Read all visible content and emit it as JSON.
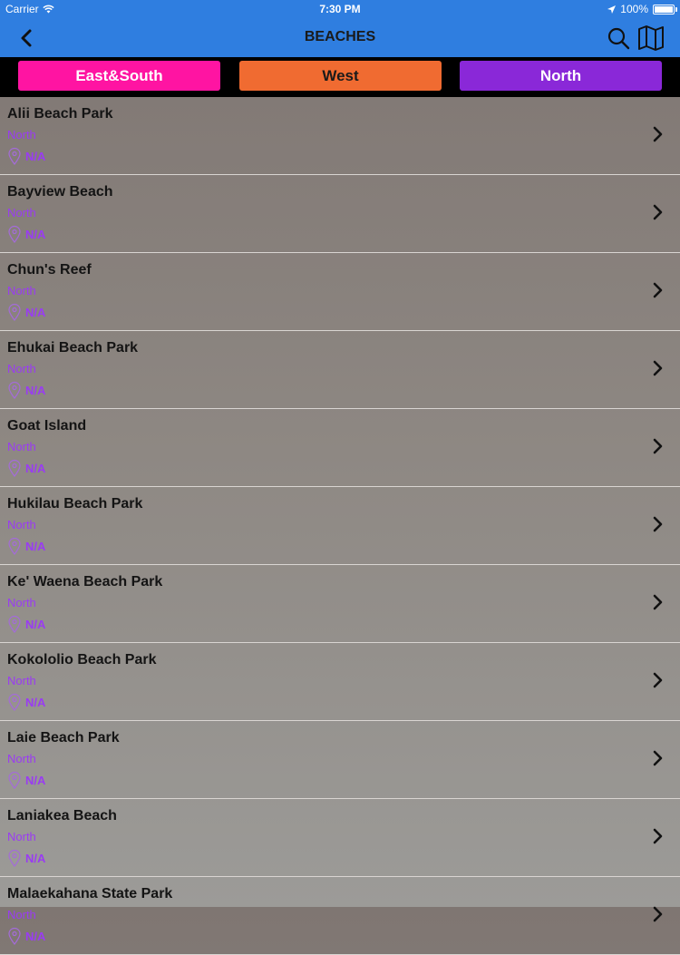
{
  "status": {
    "carrier": "Carrier",
    "time": "7:30 PM",
    "battery": "100%"
  },
  "nav": {
    "title": "BEACHES"
  },
  "tabs": [
    {
      "label": "East&South"
    },
    {
      "label": "West"
    },
    {
      "label": "North"
    }
  ],
  "beaches": [
    {
      "name": "Alii Beach Park",
      "region": "North",
      "location": "N/A"
    },
    {
      "name": "Bayview Beach",
      "region": "North",
      "location": "N/A"
    },
    {
      "name": "Chun's Reef",
      "region": "North",
      "location": "N/A"
    },
    {
      "name": "Ehukai Beach Park",
      "region": "North",
      "location": "N/A"
    },
    {
      "name": "Goat Island",
      "region": "North",
      "location": "N/A"
    },
    {
      "name": "Hukilau Beach Park",
      "region": "North",
      "location": "N/A"
    },
    {
      "name": "Ke' Waena Beach Park",
      "region": "North",
      "location": "N/A"
    },
    {
      "name": "Kokololio Beach Park",
      "region": "North",
      "location": "N/A"
    },
    {
      "name": "Laie Beach Park",
      "region": "North",
      "location": "N/A"
    },
    {
      "name": "Laniakea Beach",
      "region": "North",
      "location": "N/A"
    },
    {
      "name": "Malaekahana State Park",
      "region": "North",
      "location": "N/A"
    }
  ],
  "colors": {
    "nav_blue": "#2f7ee0",
    "east_south": "#ff14a2",
    "west": "#f06b31",
    "north": "#8a28d8",
    "region_text": "#9a3bf3"
  }
}
